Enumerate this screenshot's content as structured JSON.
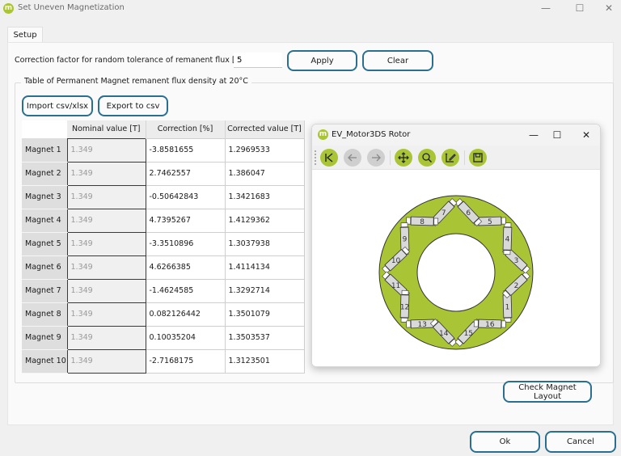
{
  "window": {
    "title": "Set Uneven Magnetization",
    "logo_letter": "m",
    "controls": {
      "minimize": "—",
      "maximize": "☐",
      "close": "✕"
    }
  },
  "tabs": [
    {
      "label": "Setup",
      "active": true
    }
  ],
  "correction": {
    "label": "Correction factor for random tolerance of remanent flux [%]",
    "value": "5",
    "apply_label": "Apply",
    "clear_label": "Clear"
  },
  "group": {
    "title": "Table of Permanent Magnet remanent flux density at 20°C",
    "import_label": "Import csv/xlsx",
    "export_label": "Export to csv"
  },
  "table": {
    "columns": [
      "Nominal value [T]",
      "Correction [%]",
      "Corrected value [T]"
    ],
    "rows": [
      {
        "name": "Magnet 1",
        "nominal": "1.349",
        "correction": "-3.8581655",
        "corrected": "1.2969533"
      },
      {
        "name": "Magnet 2",
        "nominal": "1.349",
        "correction": "2.7462557",
        "corrected": "1.386047"
      },
      {
        "name": "Magnet 3",
        "nominal": "1.349",
        "correction": "-0.50642843",
        "corrected": "1.3421683"
      },
      {
        "name": "Magnet 4",
        "nominal": "1.349",
        "correction": "4.7395267",
        "corrected": "1.4129362"
      },
      {
        "name": "Magnet 5",
        "nominal": "1.349",
        "correction": "-3.3510896",
        "corrected": "1.3037938"
      },
      {
        "name": "Magnet 6",
        "nominal": "1.349",
        "correction": "4.6266385",
        "corrected": "1.4114134"
      },
      {
        "name": "Magnet 7",
        "nominal": "1.349",
        "correction": "-1.4624585",
        "corrected": "1.3292714"
      },
      {
        "name": "Magnet 8",
        "nominal": "1.349",
        "correction": "0.082126442",
        "corrected": "1.3501079"
      },
      {
        "name": "Magnet 9",
        "nominal": "1.349",
        "correction": "0.10035204",
        "corrected": "1.3503537"
      },
      {
        "name": "Magnet 10",
        "nominal": "1.349",
        "correction": "-2.7168175",
        "corrected": "1.3123501"
      }
    ]
  },
  "rotor_window": {
    "title": "EV_Motor3DS Rotor",
    "toolbar": [
      {
        "name": "home",
        "icon": "home-icon",
        "enabled": true
      },
      {
        "name": "back",
        "icon": "arrow-left-icon",
        "enabled": false
      },
      {
        "name": "forward",
        "icon": "arrow-right-icon",
        "enabled": false
      },
      {
        "name": "pan",
        "icon": "pan-icon",
        "enabled": true
      },
      {
        "name": "zoom",
        "icon": "zoom-icon",
        "enabled": true
      },
      {
        "name": "edit-axes",
        "icon": "edit-axes-icon",
        "enabled": true
      },
      {
        "name": "save",
        "icon": "save-icon",
        "enabled": true
      }
    ],
    "magnet_count": 16,
    "magnet_labels": [
      "1",
      "2",
      "3",
      "4",
      "5",
      "6",
      "7",
      "8",
      "9",
      "10",
      "11",
      "12",
      "13",
      "14",
      "15",
      "16"
    ],
    "colors": {
      "rotor": "#a9c434",
      "magnet": "#d9d9d9",
      "outline": "#333333"
    }
  },
  "buttons": {
    "check_layout": "Check Magnet Layout",
    "ok": "Ok",
    "cancel": "Cancel"
  },
  "colors": {
    "button_border": "#2b6f90",
    "accent": "#a9c434"
  }
}
